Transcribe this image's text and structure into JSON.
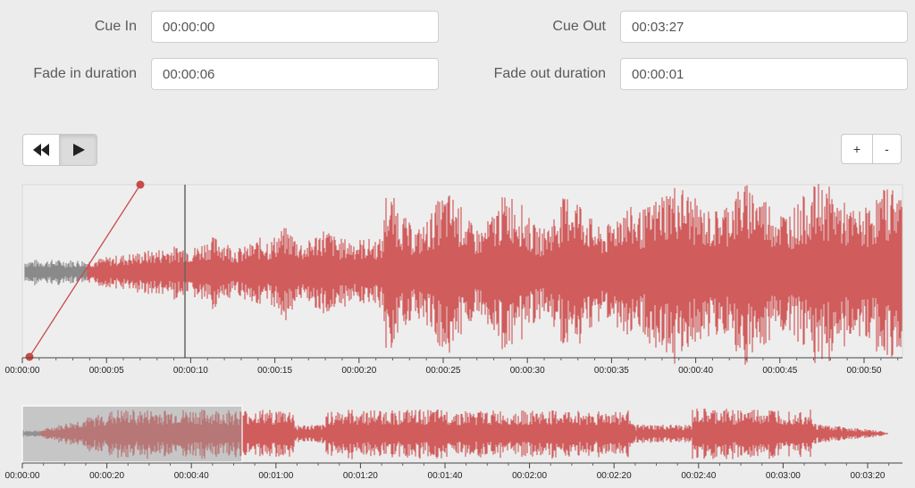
{
  "form": {
    "cue_in_label": "Cue In",
    "cue_in_value": "00:00:00",
    "cue_out_label": "Cue Out",
    "cue_out_value": "00:03:27",
    "fade_in_label": "Fade in duration",
    "fade_in_value": "00:00:06",
    "fade_out_label": "Fade out duration",
    "fade_out_value": "00:00:01"
  },
  "transport": {
    "rewind_icon": "rewind-icon",
    "play_icon": "play-icon"
  },
  "zoom": {
    "zoom_in_label": "+",
    "zoom_out_label": "-"
  },
  "waveform": {
    "color": "#d05c5c",
    "muted_color": "#8a8a8a",
    "fade_line_color": "#c94a4a",
    "background": "#eeeeee",
    "selection_color": "#b8b8b8",
    "playhead_time": "00:00:09.7",
    "main_ticks": [
      "00:00:00",
      "00:00:05",
      "00:00:10",
      "00:00:15",
      "00:00:20",
      "00:00:25",
      "00:00:30",
      "00:00:35",
      "00:00:40",
      "00:00:45",
      "00:00:50"
    ],
    "overview_ticks": [
      "00:00:00",
      "00:00:20",
      "00:00:40",
      "00:01:00",
      "00:01:20",
      "00:01:40",
      "00:02:00",
      "00:02:20",
      "00:02:40",
      "00:03:00",
      "00:03:20"
    ]
  }
}
